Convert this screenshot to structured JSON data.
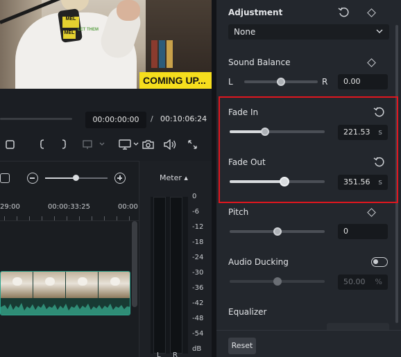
{
  "preview": {
    "caption": "COMING UP...",
    "mic_label": "MEL",
    "mic_label_2": "MEL",
    "shirt_text": "LET THEM"
  },
  "transport": {
    "current_time": "00:00:00:00",
    "separator": "/",
    "total_time": "00:10:06:24"
  },
  "timeline": {
    "ruler": [
      "29:00",
      "00:00:33:25",
      "00:00:"
    ]
  },
  "meter": {
    "title": "Meter ▴",
    "db_labels": [
      "0",
      "-6",
      "-12",
      "-18",
      "-24",
      "-30",
      "-36",
      "-42",
      "-48",
      "-54",
      "dB"
    ],
    "channels": [
      "L",
      "R"
    ]
  },
  "panel": {
    "adjustment": {
      "title": "Adjustment",
      "dropdown_value": "None"
    },
    "sound_balance": {
      "title": "Sound Balance",
      "left": "L",
      "right": "R",
      "value": "0.00",
      "level": 0.5
    },
    "fade_in": {
      "title": "Fade In",
      "value": "221.53",
      "unit": "s",
      "level": 0.37
    },
    "fade_out": {
      "title": "Fade Out",
      "value": "351.56",
      "unit": "s",
      "level": 0.58
    },
    "pitch": {
      "title": "Pitch",
      "value": "0",
      "level": 0.5
    },
    "audio_ducking": {
      "title": "Audio Ducking",
      "value": "50.00",
      "unit": "%",
      "level": 0.5,
      "enabled": false
    },
    "equalizer": {
      "title": "Equalizer"
    },
    "reset_label": "Reset"
  },
  "colors": {
    "highlight": "#e0161f",
    "caption_bg": "#f6de1d",
    "clip_border": "#2aa38c"
  }
}
